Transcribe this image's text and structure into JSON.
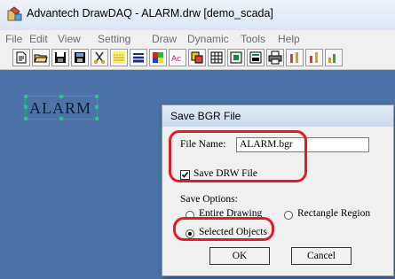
{
  "window": {
    "title": "Advantech DrawDAQ - ALARM.drw [demo_scada]"
  },
  "menu": [
    "File",
    "Edit",
    "View",
    "Setting",
    "Draw",
    "Dynamic",
    "Tools",
    "Help"
  ],
  "toolbar": {
    "buttons": [
      "new-icon",
      "open-icon",
      "save-icon",
      "save-all-icon",
      "cut-icon",
      "line-style-icon",
      "fill-style-icon",
      "color-icon",
      "font-icon",
      "copy-icon",
      "grid-icon",
      "align-icon",
      "properties-icon",
      "print-icon",
      "tool-a-icon",
      "tool-b-icon",
      "tool-c-icon"
    ]
  },
  "canvas": {
    "object_text": "ALARM",
    "background_color": "#4c74a8"
  },
  "dialog": {
    "title": "Save BGR File",
    "file_name_label": "File Name:",
    "file_name_value": "ALARM.bgr",
    "save_drw_label": "Save DRW File",
    "save_drw_checked": true,
    "save_options_label": "Save Options:",
    "options": {
      "entire_drawing": "Entire Drawing",
      "rectangle_region": "Rectangle Region",
      "selected_objects": "Selected Objects"
    },
    "selected_option": "selected_objects",
    "ok_label": "OK",
    "cancel_label": "Cancel"
  },
  "annotation_color": "#e31b23"
}
